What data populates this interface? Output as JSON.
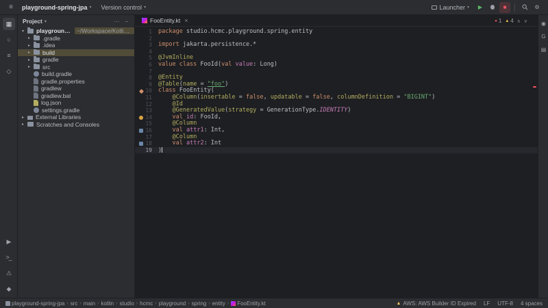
{
  "colors": {
    "accent": "#3574f0",
    "error": "#f75464",
    "warning": "#f2c55c",
    "selection_highlight": "#514c38",
    "editor_background": "#1e1f22",
    "panel_background": "#2b2d30"
  },
  "glyphs": {
    "menu": "≡",
    "chevron-down": "▾",
    "chevron-right": "▸",
    "close": "×",
    "play": "▶",
    "stop": "■",
    "gear": "⚙",
    "warning": "▲",
    "error-dot": "●",
    "up": "∧",
    "down": "∨",
    "breadcrumb-sep": "›",
    "more": "⋯",
    "minus": "−"
  },
  "strip_glyphs": {
    "project": "▦",
    "commit": "○",
    "structure": "≡",
    "bookmarks": "◇",
    "run": "▶",
    "terminal": ">_",
    "problems": "⚠",
    "services": "◆",
    "notifications": "◉",
    "gradle": "G",
    "database": "▤"
  },
  "title_bar": {
    "project_button": "playground-spring-jpa",
    "vcs_button": "Version control",
    "launcher_button": "Launcher"
  },
  "left_strip": {
    "top": [
      "project",
      "commit",
      "structure",
      "bookmarks"
    ],
    "bottom": [
      "run",
      "terminal",
      "problems",
      "services"
    ]
  },
  "right_strip": [
    "notifications",
    "gradle",
    "database"
  ],
  "project_panel": {
    "title": "Project",
    "root_name": "playground-spring-jpa",
    "root_path": "~/Workspace/Kotlin/playground-spring",
    "items": [
      {
        "label": ".gradle",
        "kind": "folder",
        "chevron": true
      },
      {
        "label": ".idea",
        "kind": "folder",
        "chevron": true
      },
      {
        "label": "build",
        "kind": "folder",
        "chevron": true,
        "selected": true
      },
      {
        "label": "gradle",
        "kind": "folder",
        "chevron": true
      },
      {
        "label": "src",
        "kind": "folder",
        "chevron": true
      },
      {
        "label": "build.gradle",
        "kind": "gradle-file"
      },
      {
        "label": "gradle.properties",
        "kind": "properties-file"
      },
      {
        "label": "gradlew",
        "kind": "script-file"
      },
      {
        "label": "gradlew.bat",
        "kind": "script-file"
      },
      {
        "label": "log.json",
        "kind": "json-file"
      },
      {
        "label": "settings.gradle",
        "kind": "gradle-file"
      },
      {
        "label": "External Libraries",
        "kind": "libraries",
        "chevron": true,
        "top": true
      },
      {
        "label": "Scratches and Consoles",
        "kind": "scratches",
        "chevron": true,
        "top": true
      }
    ]
  },
  "editor": {
    "tab_label": "FooEntity.kt",
    "inspections": {
      "errors": "1",
      "warnings": "4"
    },
    "code_lines": [
      {
        "n": "1",
        "segs": [
          [
            "package ",
            "kw"
          ],
          [
            "studio.hcmc.playground.spring.entity",
            "def"
          ]
        ]
      },
      {
        "n": "2",
        "segs": []
      },
      {
        "n": "3",
        "segs": [
          [
            "import ",
            "kw"
          ],
          [
            "jakarta.persistence.*",
            "def"
          ]
        ]
      },
      {
        "n": "4",
        "segs": []
      },
      {
        "n": "5",
        "segs": [
          [
            "@JvmInline",
            "ann"
          ]
        ]
      },
      {
        "n": "6",
        "segs": [
          [
            "value class ",
            "kw"
          ],
          [
            "FooId",
            "def"
          ],
          [
            "(",
            "def"
          ],
          [
            "val ",
            "kw"
          ],
          [
            "value",
            "prop"
          ],
          [
            ": Long)",
            "def"
          ]
        ]
      },
      {
        "n": "7",
        "segs": []
      },
      {
        "n": "8",
        "segs": [
          [
            "@Entity",
            "ann"
          ]
        ]
      },
      {
        "n": "9",
        "segs": [
          [
            "@Table",
            "ann"
          ],
          [
            "(",
            "def"
          ],
          [
            "name",
            "ann"
          ],
          [
            " = ",
            "def"
          ],
          [
            "\"foo\"",
            "strU"
          ],
          [
            ")",
            "def"
          ]
        ]
      },
      {
        "n": "10",
        "icon": "entity",
        "segs": [
          [
            "class ",
            "kw"
          ],
          [
            "FooEntity",
            "def"
          ],
          [
            "(",
            "def"
          ]
        ]
      },
      {
        "n": "11",
        "segs": [
          [
            "    ",
            "def"
          ],
          [
            "@Column",
            "ann"
          ],
          [
            "(",
            "def"
          ],
          [
            "insertable",
            "ann"
          ],
          [
            " = ",
            "def"
          ],
          [
            "false",
            "kw"
          ],
          [
            ", ",
            "def"
          ],
          [
            "updatable",
            "ann"
          ],
          [
            " = ",
            "def"
          ],
          [
            "false",
            "kw"
          ],
          [
            ", ",
            "def"
          ],
          [
            "columnDefinition",
            "ann"
          ],
          [
            " = ",
            "def"
          ],
          [
            "\"BIGINT\"",
            "str"
          ],
          [
            ")",
            "def"
          ]
        ]
      },
      {
        "n": "12",
        "segs": [
          [
            "    ",
            "def"
          ],
          [
            "@Id",
            "ann"
          ]
        ]
      },
      {
        "n": "13",
        "segs": [
          [
            "    ",
            "def"
          ],
          [
            "@GeneratedValue",
            "ann"
          ],
          [
            "(",
            "def"
          ],
          [
            "strategy",
            "ann"
          ],
          [
            " = ",
            "def"
          ],
          [
            "GenerationType.",
            "def"
          ],
          [
            "IDENTITY",
            "con"
          ],
          [
            ")",
            "def"
          ]
        ]
      },
      {
        "n": "14",
        "icon": "id",
        "segs": [
          [
            "    ",
            "def"
          ],
          [
            "val ",
            "kw"
          ],
          [
            "id",
            "prop"
          ],
          [
            ": FooId,",
            "def"
          ]
        ]
      },
      {
        "n": "15",
        "segs": [
          [
            "    ",
            "def"
          ],
          [
            "@Column",
            "ann"
          ]
        ]
      },
      {
        "n": "16",
        "icon": "column",
        "segs": [
          [
            "    ",
            "def"
          ],
          [
            "val ",
            "kw"
          ],
          [
            "attr1",
            "prop"
          ],
          [
            ": Int,",
            "def"
          ]
        ]
      },
      {
        "n": "17",
        "segs": [
          [
            "    ",
            "def"
          ],
          [
            "@Column",
            "ann"
          ]
        ]
      },
      {
        "n": "18",
        "icon": "column",
        "segs": [
          [
            "    ",
            "def"
          ],
          [
            "val ",
            "kw"
          ],
          [
            "attr2",
            "prop"
          ],
          [
            ": Int",
            "def"
          ]
        ]
      },
      {
        "n": "19",
        "current": true,
        "caret": true,
        "segs": [
          [
            ")",
            "def"
          ]
        ]
      }
    ]
  },
  "status_bar": {
    "breadcrumbs": [
      {
        "label": "playground-spring-jpa",
        "icon": "module"
      },
      {
        "label": "src"
      },
      {
        "label": "main"
      },
      {
        "label": "kotlin"
      },
      {
        "label": "studio"
      },
      {
        "label": "hcmc"
      },
      {
        "label": "playground"
      },
      {
        "label": "spring"
      },
      {
        "label": "entity"
      },
      {
        "label": "FooEntity.kt",
        "icon": "kotlin"
      }
    ],
    "aws_status": "AWS: AWS Builder ID Expired",
    "line_separator": "LF",
    "encoding": "UTF-8",
    "indent": "4 spaces"
  }
}
